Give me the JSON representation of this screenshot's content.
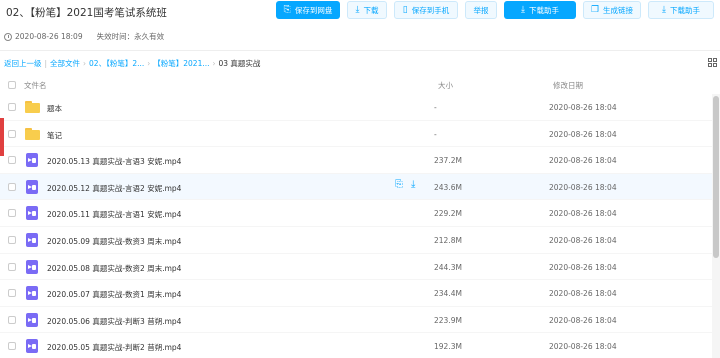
{
  "header": {
    "title": "02、【粉笔】2021国考笔试系统班",
    "created": "2020-08-26 18:09",
    "expiry": "失效时间：永久有效"
  },
  "toolbar": {
    "save_to_disk": "保存到网盘",
    "download": "下载",
    "save_to_phone": "保存到手机",
    "report": "举报",
    "download_helper": "下载助手",
    "generate_link": "生成链接",
    "download_helper_2": "下载助手"
  },
  "breadcrumb": {
    "back": "返回上一级",
    "all_files": "全部文件",
    "level1": "02、【粉笔】2...",
    "level2": "【粉笔】2021...",
    "current": "03 真题实战"
  },
  "columns": {
    "name": "文件名",
    "size": "大小",
    "date": "修改日期"
  },
  "files": [
    {
      "type": "folder",
      "name": "题本",
      "size": "-",
      "date": "2020-08-26 18:04"
    },
    {
      "type": "folder",
      "name": "笔记",
      "size": "-",
      "date": "2020-08-26 18:04"
    },
    {
      "type": "video",
      "name": "2020.05.13 真题实战-言语3 安妮.mp4",
      "size": "237.2M",
      "date": "2020-08-26 18:04"
    },
    {
      "type": "video",
      "name": "2020.05.12 真题实战-言语2 安妮.mp4",
      "size": "243.6M",
      "date": "2020-08-26 18:04"
    },
    {
      "type": "video",
      "name": "2020.05.11 真题实战-言语1 安妮.mp4",
      "size": "229.2M",
      "date": "2020-08-26 18:04"
    },
    {
      "type": "video",
      "name": "2020.05.09 真题实战-数资3 周末.mp4",
      "size": "212.8M",
      "date": "2020-08-26 18:04"
    },
    {
      "type": "video",
      "name": "2020.05.08 真题实战-数资2 周末.mp4",
      "size": "244.3M",
      "date": "2020-08-26 18:04"
    },
    {
      "type": "video",
      "name": "2020.05.07 真题实战-数资1 周末.mp4",
      "size": "234.4M",
      "date": "2020-08-26 18:04"
    },
    {
      "type": "video",
      "name": "2020.05.06 真题实战-判断3 苜朔.mp4",
      "size": "223.9M",
      "date": "2020-08-26 18:04"
    },
    {
      "type": "video",
      "name": "2020.05.05 真题实战-判断2 苜朔.mp4",
      "size": "192.3M",
      "date": "2020-08-26 18:04"
    }
  ],
  "icons": {
    "save": "save-to-disk-icon",
    "download": "download-icon",
    "phone": "phone-icon",
    "link": "link-icon",
    "grid": "grid-view-icon"
  },
  "colors": {
    "accent": "#06a7ff",
    "folder": "#f8cd4d",
    "video": "#7a6bf5"
  }
}
